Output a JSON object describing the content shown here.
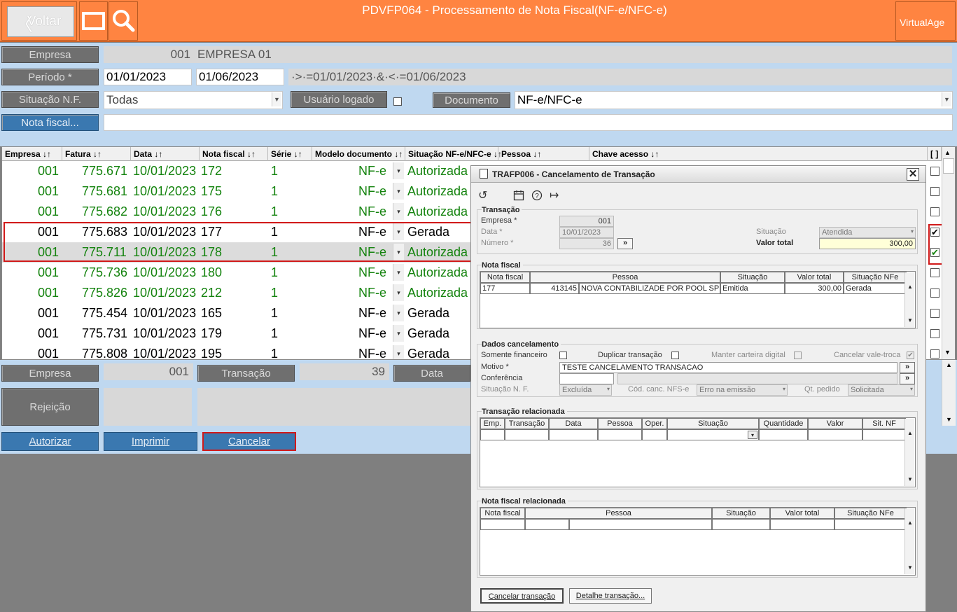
{
  "header": {
    "back_label": "Voltar",
    "title": "PDVFP064 - Processamento de Nota Fiscal(NF-e/NFC-e)",
    "brand": "VirtualAge"
  },
  "filters": {
    "empresa_label": "Empresa",
    "empresa_code": "001",
    "empresa_name": "EMPRESA 01",
    "periodo_label": "Período *",
    "periodo_start": "01/01/2023",
    "periodo_end": "01/06/2023",
    "periodo_expr": "·>·=01/01/2023·&·<·=01/06/2023",
    "situacao_label": "Situação N.F.",
    "situacao_value": "Todas",
    "usuario_label": "Usuário logado",
    "documento_label": "Documento",
    "documento_value": "NF-e/NFC-e",
    "nota_label": "Nota fiscal..."
  },
  "grid": {
    "headers": [
      "Empresa ↓↑",
      "Fatura ↓↑",
      "Data ↓↑",
      "Nota fiscal ↓↑",
      "Série ↓↑",
      "Modelo documento ↓↑",
      "Situação NF-e/NFC-e ↓↑",
      "Pessoa ↓↑",
      "Chave acesso ↓↑",
      "[ ]"
    ],
    "rows": [
      {
        "empresa": "001",
        "fatura": "775.671",
        "data": "10/01/2023",
        "nota": "172",
        "serie": "1",
        "modelo": "NF-e",
        "situacao": "Autorizada",
        "checked": ""
      },
      {
        "empresa": "001",
        "fatura": "775.681",
        "data": "10/01/2023",
        "nota": "175",
        "serie": "1",
        "modelo": "NF-e",
        "situacao": "Autorizada",
        "checked": ""
      },
      {
        "empresa": "001",
        "fatura": "775.682",
        "data": "10/01/2023",
        "nota": "176",
        "serie": "1",
        "modelo": "NF-e",
        "situacao": "Autorizada",
        "checked": ""
      },
      {
        "empresa": "001",
        "fatura": "775.683",
        "data": "10/01/2023",
        "nota": "177",
        "serie": "1",
        "modelo": "NF-e",
        "situacao": "Gerada",
        "checked": "✔"
      },
      {
        "empresa": "001",
        "fatura": "775.711",
        "data": "10/01/2023",
        "nota": "178",
        "serie": "1",
        "modelo": "NF-e",
        "situacao": "Autorizada",
        "checked": "✔"
      },
      {
        "empresa": "001",
        "fatura": "775.736",
        "data": "10/01/2023",
        "nota": "180",
        "serie": "1",
        "modelo": "NF-e",
        "situacao": "Autorizada",
        "checked": ""
      },
      {
        "empresa": "001",
        "fatura": "775.826",
        "data": "10/01/2023",
        "nota": "212",
        "serie": "1",
        "modelo": "NF-e",
        "situacao": "Autorizada",
        "checked": ""
      },
      {
        "empresa": "001",
        "fatura": "775.454",
        "data": "10/01/2023",
        "nota": "165",
        "serie": "1",
        "modelo": "NF-e",
        "situacao": "Gerada",
        "checked": ""
      },
      {
        "empresa": "001",
        "fatura": "775.731",
        "data": "10/01/2023",
        "nota": "179",
        "serie": "1",
        "modelo": "NF-e",
        "situacao": "Gerada",
        "checked": ""
      },
      {
        "empresa": "001",
        "fatura": "775.808",
        "data": "10/01/2023",
        "nota": "195",
        "serie": "1",
        "modelo": "NF-e",
        "situacao": "Gerada",
        "checked": ""
      }
    ]
  },
  "bottom": {
    "empresa_label": "Empresa",
    "empresa_value": "001",
    "transacao_label": "Transação",
    "transacao_value": "39",
    "data_label": "Data",
    "rejeicao_label": "Rejeição",
    "autorizar_label": "Autorizar",
    "imprimir_label": "Imprimir",
    "cancelar_label": "Cancelar"
  },
  "modal": {
    "title": "TRAFP006 - Cancelamento de Transação",
    "transacao_section": "Transação",
    "empresa_label": "Empresa *",
    "empresa_value": "001",
    "data_label": "Data *",
    "data_value": "10/01/2023",
    "numero_label": "Número *",
    "numero_value": "36",
    "situacao_label": "Situação",
    "situacao_value": "Atendida",
    "valor_total_label": "Valor total",
    "valor_total_value": "300,00",
    "nota_section": "Nota fiscal",
    "nota_headers": [
      "Nota fiscal",
      "Pessoa",
      "Situação",
      "Valor total",
      "Situação NFe"
    ],
    "nota_row": {
      "nota": "177",
      "pessoa_code": "413145",
      "pessoa_name": "NOVA CONTABILIZADE POR POOL SPED",
      "situacao": "Emitida",
      "valor": "300,00",
      "situacao_nfe": "Gerada"
    },
    "dados_section": "Dados cancelamento",
    "somente_fin_label": "Somente financeiro",
    "duplicar_label": "Duplicar transação",
    "manter_label": "Manter carteira digital",
    "cancelar_vale_label": "Cancelar vale-troca",
    "motivo_label": "Motivo *",
    "motivo_value": "TESTE CANCELAMENTO TRANSACAO",
    "conferencia_label": "Conferência",
    "situacao_nf_label": "Situação N. F.",
    "situacao_nf_value": "Excluída",
    "cod_canc_label": "Cód. canc. NFS-e",
    "cod_canc_value": "Erro na emissão",
    "qt_pedido_label": "Qt. pedido",
    "qt_pedido_value": "Solicitada",
    "transacao_rel_section": "Transação relacionada",
    "transacao_rel_headers": [
      "Emp.",
      "Transação",
      "Data",
      "Pessoa",
      "Oper.",
      "Situação",
      "Quantidade",
      "Valor",
      "Sit. NF"
    ],
    "nota_rel_section": "Nota fiscal relacionada",
    "nota_rel_headers": [
      "Nota fiscal",
      "Pessoa",
      "Situação",
      "Valor total",
      "Situação NFe"
    ],
    "cancelar_btn": "Cancelar transação",
    "detalhe_btn": "Detalhe transação..."
  }
}
